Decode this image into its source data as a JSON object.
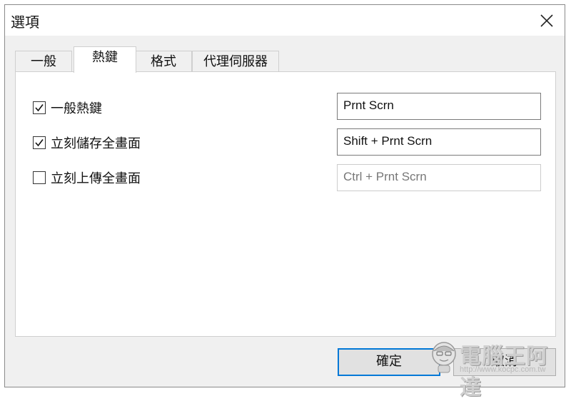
{
  "window": {
    "title": "選項"
  },
  "tabs": [
    {
      "label": "一般",
      "active": false
    },
    {
      "label": "熱鍵",
      "active": true
    },
    {
      "label": "格式",
      "active": false
    },
    {
      "label": "代理伺服器",
      "active": false
    }
  ],
  "hotkeys": [
    {
      "label": "一般熱鍵",
      "checked": true,
      "value": "Prnt Scrn",
      "enabled": true
    },
    {
      "label": "立刻儲存全畫面",
      "checked": true,
      "value": "Shift + Prnt Scrn",
      "enabled": true
    },
    {
      "label": "立刻上傳全畫面",
      "checked": false,
      "value": "Ctrl + Prnt Scrn",
      "enabled": false
    }
  ],
  "buttons": {
    "ok_label": "確定",
    "cancel_label": "取消"
  },
  "watermark": {
    "text": "電腦王阿達",
    "url": "http://www.kocpc.com.tw"
  },
  "colors": {
    "accent": "#0078d7",
    "panel": "#ffffff",
    "window": "#f0f0f0"
  }
}
